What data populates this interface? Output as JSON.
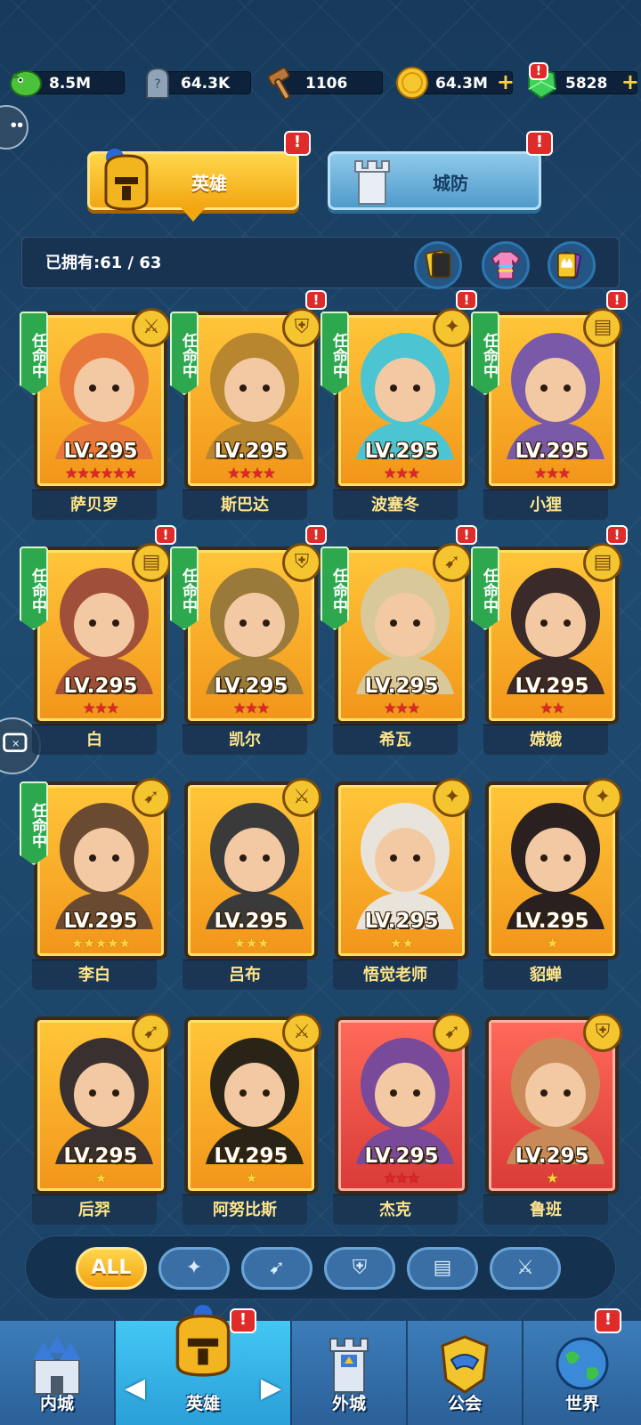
{
  "resources": [
    {
      "icon": "green-dragon-icon",
      "value": "8.5M",
      "plus": false
    },
    {
      "icon": "tombstone-icon",
      "value": "64.3K",
      "plus": false
    },
    {
      "icon": "hammer-icon",
      "value": "1106",
      "plus": false
    },
    {
      "icon": "gold-coin-icon",
      "value": "64.3M",
      "plus": true
    },
    {
      "icon": "green-gem-icon",
      "value": "5828",
      "plus": true
    }
  ],
  "plus_sign": "+",
  "tabs": {
    "hero": "英雄",
    "defense": "城防"
  },
  "badge_mark": "!",
  "owned": {
    "label": "已拥有:",
    "count": "61 / 63"
  },
  "appoint_label": "任命中",
  "heroes": [
    {
      "name": "萨贝罗",
      "level": "LV.295",
      "stars": 6,
      "star_color": "red",
      "class": "sword",
      "appointed": true,
      "badge": false,
      "frame": "gold",
      "color": "#e8773b"
    },
    {
      "name": "斯巴达",
      "level": "LV.295",
      "stars": 4,
      "star_color": "red",
      "class": "shield",
      "appointed": true,
      "badge": true,
      "frame": "gold",
      "color": "#b8862e"
    },
    {
      "name": "波塞冬",
      "level": "LV.295",
      "stars": 3,
      "star_color": "red",
      "class": "staff",
      "appointed": true,
      "badge": true,
      "frame": "gold",
      "color": "#4cc4d2"
    },
    {
      "name": "小狸",
      "level": "LV.295",
      "stars": 3,
      "star_color": "red",
      "class": "book",
      "appointed": true,
      "badge": true,
      "frame": "gold",
      "color": "#7a5aa8"
    },
    {
      "name": "白",
      "level": "LV.295",
      "stars": 3,
      "star_color": "red",
      "class": "book",
      "appointed": true,
      "badge": true,
      "frame": "gold",
      "color": "#a0503a"
    },
    {
      "name": "凯尔",
      "level": "LV.295",
      "stars": 3,
      "star_color": "red",
      "class": "shield",
      "appointed": true,
      "badge": true,
      "frame": "gold",
      "color": "#9a7a3a"
    },
    {
      "name": "希瓦",
      "level": "LV.295",
      "stars": 3,
      "star_color": "red",
      "class": "bow",
      "appointed": true,
      "badge": true,
      "frame": "gold",
      "color": "#d8c89a"
    },
    {
      "name": "嫦娥",
      "level": "LV.295",
      "stars": 2,
      "star_color": "red",
      "class": "book",
      "appointed": true,
      "badge": true,
      "frame": "gold",
      "color": "#3a2a2a"
    },
    {
      "name": "李白",
      "level": "LV.295",
      "stars": 5,
      "star_color": "gold",
      "class": "bow",
      "appointed": true,
      "badge": false,
      "frame": "gold",
      "color": "#6a4a30"
    },
    {
      "name": "吕布",
      "level": "LV.295",
      "stars": 3,
      "star_color": "gold",
      "class": "sword",
      "appointed": false,
      "badge": false,
      "frame": "gold",
      "color": "#3a3a3a"
    },
    {
      "name": "悟觉老师",
      "level": "LV.295",
      "stars": 2,
      "star_color": "gold",
      "class": "staff",
      "appointed": false,
      "badge": false,
      "frame": "gold",
      "color": "#e8e4dc"
    },
    {
      "name": "貂蝉",
      "level": "LV.295",
      "stars": 1,
      "star_color": "gold",
      "class": "staff",
      "appointed": false,
      "badge": false,
      "frame": "gold",
      "color": "#2a2020"
    },
    {
      "name": "后羿",
      "level": "LV.295",
      "stars": 1,
      "star_color": "gold",
      "class": "bow",
      "appointed": false,
      "badge": false,
      "frame": "gold",
      "color": "#3a3030"
    },
    {
      "name": "阿努比斯",
      "level": "LV.295",
      "stars": 1,
      "star_color": "gold",
      "class": "sword",
      "appointed": false,
      "badge": false,
      "frame": "gold",
      "color": "#2a2418"
    },
    {
      "name": "杰克",
      "level": "LV.295",
      "stars": 3,
      "star_color": "red",
      "class": "bow",
      "appointed": false,
      "badge": false,
      "frame": "red",
      "color": "#7a4a9a"
    },
    {
      "name": "鲁班",
      "level": "LV.295",
      "stars": 1,
      "star_color": "gold",
      "class": "shield",
      "appointed": false,
      "badge": false,
      "frame": "red",
      "color": "#c98a5a"
    }
  ],
  "filters": [
    {
      "label": "ALL",
      "icon": "all-text",
      "active": true
    },
    {
      "label": "",
      "icon": "staff-icon",
      "active": false
    },
    {
      "label": "",
      "icon": "bow-icon",
      "active": false
    },
    {
      "label": "",
      "icon": "shield-icon",
      "active": false
    },
    {
      "label": "",
      "icon": "book-icon",
      "active": false
    },
    {
      "label": "",
      "icon": "sword-icon",
      "active": false
    }
  ],
  "nav": [
    {
      "label": "内城",
      "icon": "castle-icon"
    },
    {
      "label": "英雄",
      "icon": "knight-helmet-icon"
    },
    {
      "label": "外城",
      "icon": "tower-icon"
    },
    {
      "label": "公会",
      "icon": "handshake-icon"
    },
    {
      "label": "世界",
      "icon": "globe-icon"
    }
  ],
  "arrows": {
    "left": "◀",
    "right": "▶"
  },
  "colors": {
    "gold": "#f5c530",
    "red_badge": "#e02b2b",
    "green_appoint": "#2ea84e",
    "bg": "#1d4368"
  }
}
